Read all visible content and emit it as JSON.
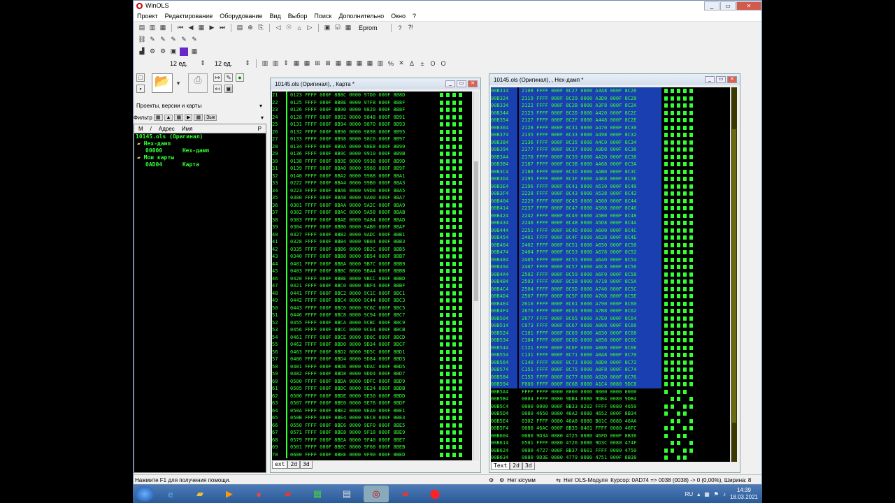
{
  "app": {
    "title": "WinOLS"
  },
  "menu": [
    "Проект",
    "Редактирование",
    "Оборудование",
    "Вид",
    "Выбор",
    "Поиск",
    "Дополнительно",
    "Окно",
    "?"
  ],
  "toolbar": {
    "eprom_label": "Eprom",
    "unit1": "12 ед.",
    "unit2": "12 ед."
  },
  "left": {
    "dropdown": "Проекты, версии и карты",
    "filter_label": "Фильтр",
    "filter_btn": "Зык",
    "col_m": "М",
    "col_sort": "/",
    "col_addr": "Адрес",
    "col_name": "Имя",
    "col_p": "Р",
    "tree": [
      {
        "addr": "10145.ols (Оригинал)",
        "name": ""
      },
      {
        "addr": "Hex-дамп",
        "name": ""
      },
      {
        "addr": "00000",
        "name": "Hex-дамп"
      },
      {
        "addr": "Мои карты",
        "name": ""
      },
      {
        "addr": "0AD04",
        "name": "Карта"
      }
    ]
  },
  "win1": {
    "title": "10145.ols (Оригинал), , Карта *",
    "tabs": [
      "ext",
      "2d",
      "3d"
    ],
    "rows": [
      [
        "21",
        "0123 FFFF 000F 8B8C 0000 97D0 000F 8B8D"
      ],
      [
        "22",
        "0125 FFFF 000F 8B8E 0000 97F8 000F 8B8F"
      ],
      [
        "23",
        "0126 FFFF 000F 8B90 0000 9820 000F 8B8F"
      ],
      [
        "24",
        "0128 FFFF 000F 8B92 0000 9848 000F 8B91"
      ],
      [
        "25",
        "0131 FFFF 000F 8B94 0000 9870 000F 8B93"
      ],
      [
        "26",
        "0132 FFFF 000F 8B96 0000 9898 000F 8B95"
      ],
      [
        "27",
        "0133 FFFF 000F 8B98 0000 98C0 000F 8B97"
      ],
      [
        "28",
        "0134 FFFF 000F 8B9A 0000 98E8 000F 8B99"
      ],
      [
        "29",
        "0136 FFFF 000F 8B9C 0000 9910 000F 8B9B"
      ],
      [
        "30",
        "0138 FFFF 000F 8B9E 0000 9938 000F 8B9D"
      ],
      [
        "31",
        "0139 FFFF 000F 8BA0 0000 9960 000F 8B9F"
      ],
      [
        "32",
        "0140 FFFF 000F 8BA2 0000 9988 000F 8BA1"
      ],
      [
        "33",
        "0222 FFFF 000F 8BA4 0000 99B0 000F 8BA3"
      ],
      [
        "34",
        "0223 FFFF 000F 8BA6 0000 99D8 000F 8BA5"
      ],
      [
        "35",
        "0300 FFFF 000F 8BA8 0000 9A00 000F 8BA7"
      ],
      [
        "36",
        "0301 FFFF 000F 8BAA 0000 9A2C 000F 8BA9"
      ],
      [
        "37",
        "0302 FFFF 000F 8BAC 0000 9A58 000F 8BAB"
      ],
      [
        "38",
        "0303 FFFF 000F 8BAE 0000 9A84 000F 8BAD"
      ],
      [
        "39",
        "0304 FFFF 000F 8BB0 0000 9AB0 000F 8BAF"
      ],
      [
        "40",
        "0327 FFFF 000F 8BB2 0000 9ADC 000F 8BB1"
      ],
      [
        "41",
        "0328 FFFF 000F 8BB4 0000 9B04 000F 8BB3"
      ],
      [
        "42",
        "0335 FFFF 000F 8BB6 0000 9B2C 000F 8BB5"
      ],
      [
        "43",
        "0340 FFFF 000F 8BB8 0000 9B54 000F 8BB7"
      ],
      [
        "44",
        "0401 FFFF 000F 8BBA 0000 9B7C 000F 8BB9"
      ],
      [
        "45",
        "0403 FFFF 000F 8BBC 0000 9BA4 000F 8BBB"
      ],
      [
        "46",
        "0420 FFFF 000F 8BBE 0000 9BCC 000F 8BBD"
      ],
      [
        "47",
        "0421 FFFF 000F 8BC0 0000 9BF4 000F 8BBF"
      ],
      [
        "48",
        "0441 FFFF 000F 8BC2 0000 9C1C 000F 8BC1"
      ],
      [
        "49",
        "0442 FFFF 000F 8BC4 0000 9C44 000F 8BC3"
      ],
      [
        "50",
        "0443 FFFF 000F 8BC6 0000 9C6C 000F 8BC5"
      ],
      [
        "51",
        "0446 FFFF 000F 8BC8 0000 9C94 000F 8BC7"
      ],
      [
        "52",
        "0455 FFFF 000F 8BCA 0000 9CBC 000F 8BC9"
      ],
      [
        "53",
        "0456 FFFF 000F 8BCC 0000 9CE4 000F 8BCB"
      ],
      [
        "54",
        "0461 FFFF 000F 8BCE 0000 9D0C 000F 8BCD"
      ],
      [
        "55",
        "0462 FFFF 000F 8BD0 0000 9D34 000F 8BCF"
      ],
      [
        "56",
        "0463 FFFF 000F 8BD2 0000 9D5C 000F 8BD1"
      ],
      [
        "57",
        "0480 FFFF 000F 8BD4 0000 9D84 000F 8BD3"
      ],
      [
        "58",
        "0481 FFFF 000F 8BD6 0000 9DAC 000F 8BD5"
      ],
      [
        "59",
        "0482 FFFF 000F 8BD8 0000 9DD4 000F 8BD7"
      ],
      [
        "60",
        "0500 FFFF 000F 8BDA 0000 9DFC 000F 8BD9"
      ],
      [
        "61",
        "0505 FFFF 000F 8BDC 0000 9E24 000F 8BDB"
      ],
      [
        "62",
        "0506 FFFF 000F 8BDE 0000 9E50 000F 8BDD"
      ],
      [
        "63",
        "0507 FFFF 000F 8BE0 0000 9E78 000F 8BDF"
      ],
      [
        "64",
        "050A FFFF 000F 8BE2 0000 9EA0 000F 8BE1"
      ],
      [
        "65",
        "050B FFFF 000F 8BE4 0000 9EC8 000F 8BE3"
      ],
      [
        "66",
        "0550 FFFF 000F 8BE6 0000 9EF0 000F 8BE5"
      ],
      [
        "67",
        "0571 FFFF 000F 8BE8 0000 9F18 000F 8BE9"
      ],
      [
        "68",
        "0579 FFFF 000F 8BEA 0000 9F40 000F 8BE7"
      ],
      [
        "69",
        "0581 FFFF 000F 8BEC 0000 9F68 000F 8BEB"
      ],
      [
        "70",
        "0600 FFFF 000F 8BEE 0000 9F90 000F 8BED"
      ]
    ]
  },
  "win2": {
    "title": "10145.ols (Оригинал), , Hex-дамп *",
    "tabs": [
      "Text",
      "2d",
      "3d"
    ],
    "rows": [
      [
        "00B314",
        "2108 FFFF 000F 8C27 0000 A3A8 000F 8C26"
      ],
      [
        "00B324",
        "2119 FFFF 000F 8C29 0000 A3D0 000F 8C28"
      ],
      [
        "00B334",
        "2122 FFFF 000F 8C2B 0000 A3F8 000F 8C2A"
      ],
      [
        "00B344",
        "2123 FFFF 000F 8C2D 0000 A420 000F 8C2C"
      ],
      [
        "00B354",
        "2127 FFFF 000F 8C2F 0000 A448 000F 8C2E"
      ],
      [
        "00B364",
        "2128 FFFF 000F 8C31 0000 A470 000F 8C30"
      ],
      [
        "00B374",
        "2135 FFFF 000F 8C33 0000 A498 000F 8C32"
      ],
      [
        "00B384",
        "2136 FFFF 000F 8C35 0000 A4C0 000F 8C34"
      ],
      [
        "00B394",
        "2177 FFFF 000F 8C37 0000 A9D8 000F 8C36"
      ],
      [
        "00B3A4",
        "2178 FFFF 000F 8C39 0000 AA20 000F 8C38"
      ],
      [
        "00B3B4",
        "2187 FFFF 000F 8C3B 0000 AA68 000F 8C3A"
      ],
      [
        "00B3C4",
        "2188 FFFF 000F 8C3D 0000 AAB0 000F 8C3C"
      ],
      [
        "00B3D4",
        "2195 FFFF 000F 8C3F 0000 A4E8 000F 8C3E"
      ],
      [
        "00B3E4",
        "2196 FFFF 000F 8C41 0000 A510 000F 8C40"
      ],
      [
        "00B3F4",
        "2228 FFFF 000F 8C43 0000 A538 000F 8C42"
      ],
      [
        "00B404",
        "2229 FFFF 000F 8C45 0000 A560 000F 8C44"
      ],
      [
        "00B414",
        "2237 FFFF 000F 8C47 0000 A588 000F 8C46"
      ],
      [
        "00B424",
        "2242 FFFF 000F 8C49 0000 A5B0 000F 8C48"
      ],
      [
        "00B434",
        "2246 FFFF 000F 8C4B 0000 A5D8 000F 8C4A"
      ],
      [
        "00B444",
        "2251 FFFF 000F 8C4D 0000 A600 000F 8C4C"
      ],
      [
        "00B454",
        "2401 FFFF 000F 8C4F 0000 A628 000F 8C4E"
      ],
      [
        "00B464",
        "2402 FFFF 000F 8C51 0000 A650 000F 8C50"
      ],
      [
        "00B474",
        "2404 FFFF 000F 8C53 0000 A678 000F 8C52"
      ],
      [
        "00B484",
        "2405 FFFF 000F 8C55 0000 A6A0 000F 8C54"
      ],
      [
        "00B494",
        "2407 FFFF 000F 8C57 0000 A6C8 000F 8C56"
      ],
      [
        "00B4A4",
        "2502 FFFF 000F 8C59 0000 A6F0 000F 8C58"
      ],
      [
        "00B4B4",
        "2503 FFFF 000F 8C5B 0000 A718 000F 8C5A"
      ],
      [
        "00B4C4",
        "2504 FFFF 000F 8C5D 0000 A740 000F 8C5C"
      ],
      [
        "00B4D4",
        "2507 FFFF 000F 8C5F 0000 A768 000F 8C5E"
      ],
      [
        "00B4E4",
        "2610 FFFF 000F 8C61 0000 A790 000F 8C60"
      ],
      [
        "00B4F4",
        "2676 FFFF 000F 8C63 0000 A7B8 000F 8C62"
      ],
      [
        "00B504",
        "2677 FFFF 000F 8C65 0000 A7E0 000F 8C64"
      ],
      [
        "00B514",
        "C073 FFFF 000F 8C67 0000 A808 000F 8C66"
      ],
      [
        "00B524",
        "C101 FFFF 000F 8C69 0000 A830 000F 8C68"
      ],
      [
        "00B534",
        "C104 FFFF 000F 8C6D 0000 A858 000F 8C6C"
      ],
      [
        "00B544",
        "C121 FFFF 000F 8C6F 0000 A880 000F 8C6E"
      ],
      [
        "00B554",
        "C131 FFFF 000F 8C71 0000 A8A8 000F 8C70"
      ],
      [
        "00B564",
        "C140 FFFF 000F 8C73 0000 A8D0 000F 8C72"
      ],
      [
        "00B574",
        "C151 FFFF 000F 8C75 0000 A8F8 000F 8C74"
      ],
      [
        "00B584",
        "C155 FFFF 000F 8C77 0000 A920 000F 8C76"
      ],
      [
        "00B594",
        "F000 FFFF 000F 8C6B 0000 A1C4 0080 9DC8"
      ],
      [
        "00B5A4",
        "FFFF FFFF 0000 0000 0000 0000 0000 0000"
      ],
      [
        "00B5B4",
        "0004 FFFF 0080 9DB4 0080 9DB4 0080 9DB4"
      ],
      [
        "00B5C4",
        "0000 0000 000F 8B33 0202 FFFF 0080 4650"
      ],
      [
        "00B5D4",
        "0080 4650 0080 46A2 0080 4652 000F 8B34"
      ],
      [
        "00B5E4",
        "0302 FFFF 0080 46A8 0080 B01C 0080 46AA"
      ],
      [
        "00B5F4",
        "0080 46AC 000F 8B35 0401 FFFF 0080 46FC"
      ],
      [
        "00B604",
        "0080 9D3A 0080 4725 0080 46FD 000F 8B36"
      ],
      [
        "00B614",
        "0501 FFFF 0080 4726 0080 9D3C 0080 474F"
      ],
      [
        "00B624",
        "0080 4727 000F 8B37 0601 FFFF 0080 4750"
      ],
      [
        "00B634",
        "0080 9D3E 0080 4779 0080 4751 000F 8B38"
      ]
    ]
  },
  "status": {
    "help": "Нажмите F1 для получения помощи.",
    "checksum": "Нет к/сумм",
    "module": "Нет OLS-Модуля",
    "cursor": "Курсор: 0AD74 => 0038 (0038) -> 0 (0,00%), Ширина: 8"
  },
  "taskbar": {
    "lang": "RU",
    "time": "14:39",
    "date": "18.03.2021"
  }
}
